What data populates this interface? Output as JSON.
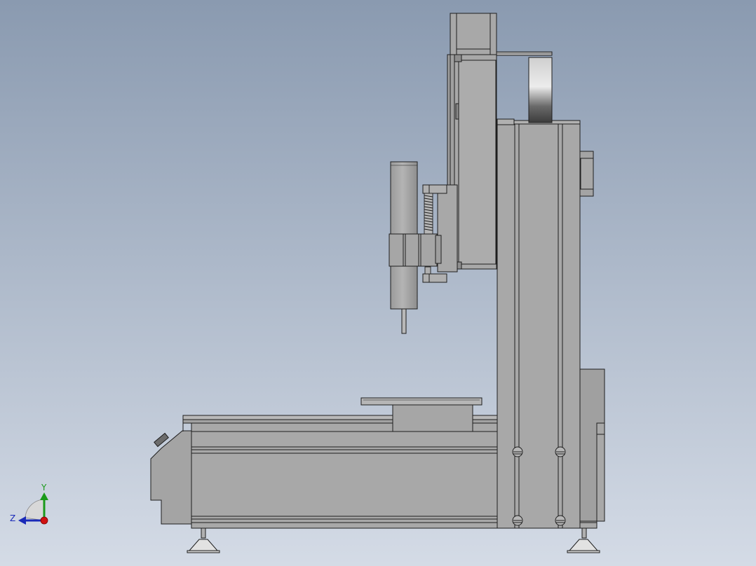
{
  "viewport": {
    "background_top": "#8a9ab0",
    "background_bottom": "#d4dbe6",
    "part_fill": "#a8a8a8",
    "part_stroke": "#1e1e1e",
    "part_light": "#c2c2c2",
    "part_dark": "#8c8c8c"
  },
  "triad": {
    "y_label": "Y",
    "z_label": "Z",
    "y_color": "#1a9a1a",
    "z_color": "#1a2ab8",
    "x_color": "#d01010"
  }
}
